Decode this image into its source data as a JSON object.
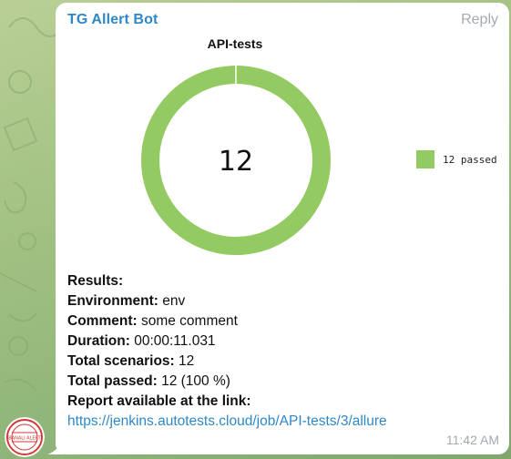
{
  "message": {
    "sender": "TG Allert Bot",
    "reply_label": "Reply",
    "time": "11:42 AM",
    "avatar_label": "BANALI ALERT"
  },
  "chart_data": {
    "type": "pie",
    "donut": true,
    "title": "API-tests",
    "center_label": "12",
    "categories": [
      "12 passed"
    ],
    "values": [
      12
    ],
    "colors": [
      "#94ca62"
    ],
    "legend_position": "right"
  },
  "details": {
    "results_label": "Results:",
    "environment_label": "Environment:",
    "environment_value": "env",
    "comment_label": "Comment:",
    "comment_value": "some comment",
    "duration_label": "Duration:",
    "duration_value": "00:00:11.031",
    "total_scenarios_label": "Total scenarios:",
    "total_scenarios_value": "12",
    "total_passed_label": "Total passed:",
    "total_passed_value": "12 (100 %)",
    "report_label": "Report available at the link:",
    "report_link": "https://jenkins.autotests.cloud/job/API-tests/3/allure"
  }
}
